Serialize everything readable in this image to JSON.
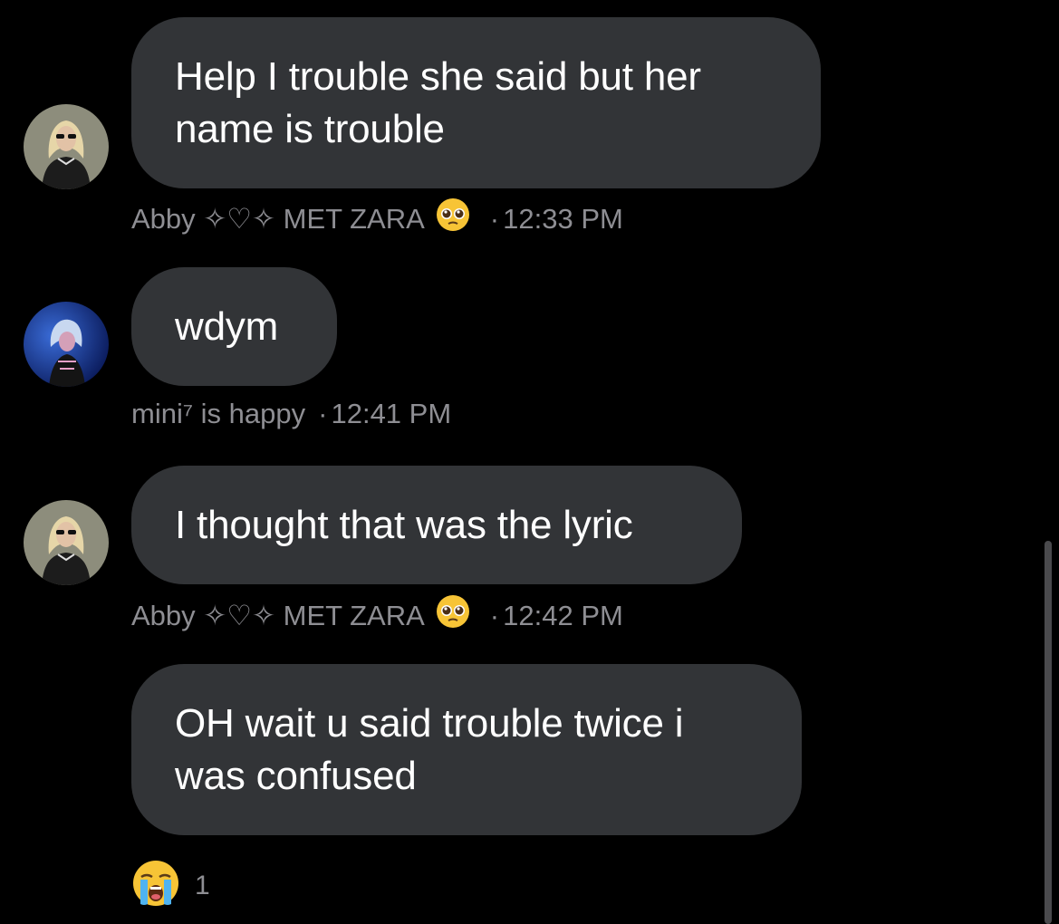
{
  "messages": [
    {
      "sender": "Abby ✧♡✧ MET ZARA",
      "sender_emoji": "pleading-face-icon",
      "text": "Help I trouble she said but her name is trouble",
      "line1": "Help I trouble she said but her",
      "line2": "name is trouble",
      "time": "12:33 PM"
    },
    {
      "sender": "mini⁷ is happy",
      "text": "wdym",
      "time": "12:41 PM"
    },
    {
      "sender": "Abby ✧♡✧ MET ZARA",
      "sender_emoji": "pleading-face-icon",
      "text": "I thought that was the lyric",
      "time": "12:42 PM"
    },
    {
      "text": "OH wait u said trouble twice i was confused",
      "line1": "OH wait u said trouble twice i",
      "line2": "was confused",
      "reaction": {
        "emoji": "loudly-crying-face-icon",
        "count": "1"
      }
    }
  ],
  "separator": "·",
  "colors": {
    "background": "#000000",
    "bubble": "#323437",
    "meta_text": "#8e8e93",
    "message_text": "#ffffff"
  }
}
